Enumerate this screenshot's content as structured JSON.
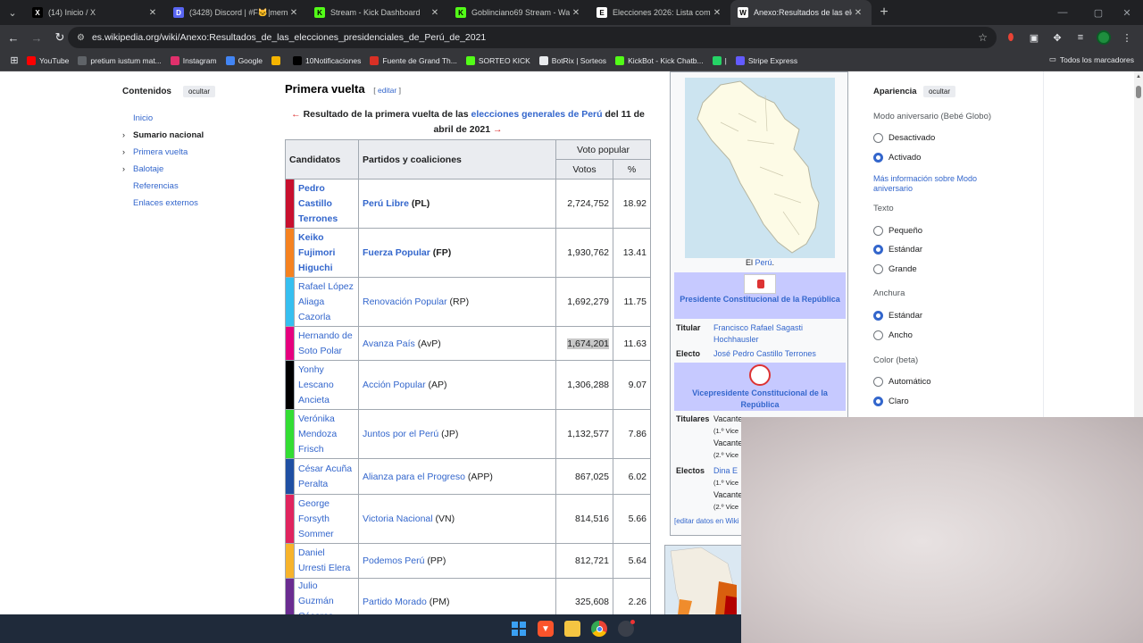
{
  "tabs": [
    {
      "title": "(14) Inicio / X",
      "fav": "X",
      "color": "#000000"
    },
    {
      "title": "(3428) Discord | #F🐱|memes |",
      "fav": "D",
      "color": "#5865f2"
    },
    {
      "title": "Stream - Kick Dashboard",
      "fav": "K",
      "color": "#53fc18"
    },
    {
      "title": "Goblinciano69 Stream - Watch",
      "fav": "K",
      "color": "#53fc18"
    },
    {
      "title": "Elecciones 2026: Lista completa",
      "fav": "E",
      "color": "#ffffff"
    },
    {
      "title": "Anexo:Resultados de las eleccio",
      "fav": "W",
      "color": "#ffffff"
    }
  ],
  "url": "es.wikipedia.org/wiki/Anexo:Resultados_de_las_elecciones_presidenciales_de_Perú_de_2021",
  "bookmarks": [
    {
      "label": "YouTube",
      "color": "#ff0000"
    },
    {
      "label": "pretium iustum mat...",
      "color": "#5f6368"
    },
    {
      "label": "Instagram",
      "color": "#e1306c"
    },
    {
      "label": "Google",
      "color": "#4285f4"
    },
    {
      "label": "",
      "color": "#f4b400"
    },
    {
      "label": "10Notificaciones",
      "color": "#000000"
    },
    {
      "label": "Fuente de Grand Th...",
      "color": "#d93025"
    },
    {
      "label": "SORTEO KICK",
      "color": "#53fc18"
    },
    {
      "label": "BotRix | Sorteos",
      "color": "#e8eaed"
    },
    {
      "label": "KickBot - Kick Chatb...",
      "color": "#53fc18"
    },
    {
      "label": "|",
      "color": "#25d366"
    },
    {
      "label": "Stripe Express",
      "color": "#635bff"
    }
  ],
  "bookmarks_all": "Todos los marcadores",
  "toc": {
    "title": "Contenidos",
    "hide": "ocultar",
    "items": [
      {
        "label": "Inicio",
        "chev": false,
        "current": false
      },
      {
        "label": "Sumario nacional",
        "chev": true,
        "current": true
      },
      {
        "label": "Primera vuelta",
        "chev": true,
        "current": false
      },
      {
        "label": "Balotaje",
        "chev": true,
        "current": false
      },
      {
        "label": "Referencias",
        "chev": false,
        "current": false
      },
      {
        "label": "Enlaces externos",
        "chev": false,
        "current": false
      }
    ]
  },
  "section": {
    "title": "Primera vuelta",
    "edit": "editar",
    "caption_pre": "Resultado de la primera vuelta de las",
    "caption_link": "elecciones generales de Perú",
    "caption_post": "del 11 de abril de 2021",
    "arrow_left": "←",
    "arrow_right": "→"
  },
  "table": {
    "h_candidates": "Candidatos",
    "h_parties": "Partidos y coaliciones",
    "h_popular": "Voto popular",
    "h_votes": "Votos",
    "h_pct": "%",
    "rows": [
      {
        "candidate": "Pedro Castillo Terrones",
        "party": "Perú Libre",
        "abbr": "(PL)",
        "votes": "2,724,752",
        "pct": "18.92",
        "color": "#c8102e",
        "bold": true
      },
      {
        "candidate": "Keiko Fujimori Higuchi",
        "party": "Fuerza Popular",
        "abbr": "(FP)",
        "votes": "1,930,762",
        "pct": "13.41",
        "color": "#f58220",
        "bold": true
      },
      {
        "candidate": "Rafael López Aliaga Cazorla",
        "party": "Renovación Popular",
        "abbr": "(RP)",
        "votes": "1,692,279",
        "pct": "11.75",
        "color": "#36bff0",
        "bold": false
      },
      {
        "candidate": "Hernando de Soto Polar",
        "party": "Avanza País",
        "abbr": "(AvP)",
        "votes": "1,674,201",
        "pct": "11.63",
        "color": "#e6007e",
        "bold": false
      },
      {
        "candidate": "Yonhy Lescano Ancieta",
        "party": "Acción Popular",
        "abbr": "(AP)",
        "votes": "1,306,288",
        "pct": "9.07",
        "color": "#000000",
        "bold": false
      },
      {
        "candidate": "Verónika Mendoza Frisch",
        "party": "Juntos por el Perú",
        "abbr": "(JP)",
        "votes": "1,132,577",
        "pct": "7.86",
        "color": "#33dd33",
        "bold": false
      },
      {
        "candidate": "César Acuña Peralta",
        "party": "Alianza para el Progreso",
        "abbr": "(APP)",
        "votes": "867,025",
        "pct": "6.02",
        "color": "#1f4fa3",
        "bold": false
      },
      {
        "candidate": "George Forsyth Sommer",
        "party": "Victoria Nacional",
        "abbr": "(VN)",
        "votes": "814,516",
        "pct": "5.66",
        "color": "#e0245e",
        "bold": false
      },
      {
        "candidate": "Daniel Urresti Elera",
        "party": "Podemos Perú",
        "abbr": "(PP)",
        "votes": "812,721",
        "pct": "5.64",
        "color": "#f7b32b",
        "bold": false
      },
      {
        "candidate": "Julio Guzmán Cáceres",
        "party": "Partido Morado",
        "abbr": "(PM)",
        "votes": "325,608",
        "pct": "2.26",
        "color": "#6a2c91",
        "bold": false
      }
    ]
  },
  "infobox": {
    "map_caption_pre": "El",
    "map_caption_link": "Perú",
    "map_caption_post": ".",
    "pres_header": "Presidente Constitucional de la República",
    "titular_k": "Titular",
    "titular_v": "Francisco Rafael Sagasti Hochhausler",
    "electo_k": "Electo",
    "electo_v": "José Pedro Castillo Terrones",
    "vp_header": "Vicepresidente Constitucional de la República",
    "titulares_k": "Titulares",
    "vacante1": "Vacante",
    "vice1": "(1.º Vice",
    "vacante2": "Vacante",
    "vice2": "(2.º Vice",
    "electos_k": "Electos",
    "electos_v": "Dina E",
    "vice3": "(1.º Vice",
    "vacante3": "Vacante",
    "vice4": "(2.º Vice",
    "edit_data": "[editar datos en Wiki"
  },
  "appearance": {
    "title": "Apariencia",
    "hide": "ocultar",
    "anniv_label": "Modo aniversario (Bebé Globo)",
    "off": "Desactivado",
    "on": "Activado",
    "more": "Más información sobre Modo aniversario",
    "text_label": "Texto",
    "small": "Pequeño",
    "standard": "Estándar",
    "large": "Grande",
    "width_label": "Anchura",
    "w_standard": "Estándar",
    "w_wide": "Ancho",
    "color_label": "Color (beta)",
    "auto": "Automático",
    "light": "Claro"
  }
}
